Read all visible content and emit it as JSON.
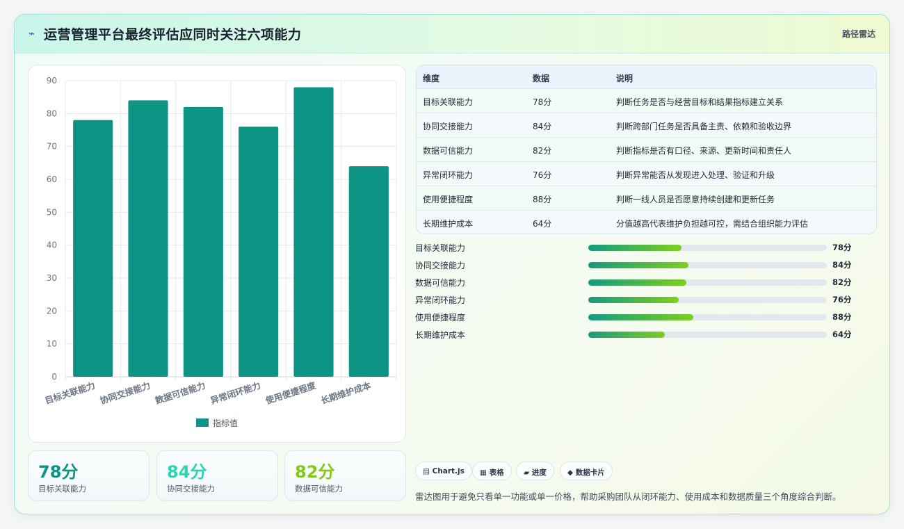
{
  "header": {
    "icon": "lightning-icon",
    "title": "运营管理平台最终评估应同时关注六项能力",
    "tag": "路径雷达"
  },
  "chart_data": {
    "type": "bar",
    "categories": [
      "目标关联能力",
      "协同交接能力",
      "数据可信能力",
      "异常闭环能力",
      "使用便捷程度",
      "长期维护成本"
    ],
    "series": [
      {
        "name": "指标值",
        "values": [
          78,
          84,
          82,
          76,
          88,
          64
        ]
      }
    ],
    "ylim": [
      0,
      90
    ],
    "yticks": [
      0,
      10,
      20,
      30,
      40,
      50,
      60,
      70,
      80,
      90
    ],
    "grid": true,
    "legend": "bottom",
    "bar_color": "#0e9484"
  },
  "stats": [
    {
      "value": "78分",
      "label": "目标关联能力",
      "color": "#0e9484"
    },
    {
      "value": "84分",
      "label": "协同交接能力",
      "color": "#2fd4b4"
    },
    {
      "value": "82分",
      "label": "数据可信能力",
      "color": "#84c81c"
    }
  ],
  "table": {
    "headers": [
      "维度",
      "数据",
      "说明"
    ],
    "rows": [
      [
        "目标关联能力",
        "78分",
        "判断任务是否与经营目标和结果指标建立关系"
      ],
      [
        "协同交接能力",
        "84分",
        "判断跨部门任务是否具备主责、依赖和验收边界"
      ],
      [
        "数据可信能力",
        "82分",
        "判断指标是否有口径、来源、更新时间和责任人"
      ],
      [
        "异常闭环能力",
        "76分",
        "判断异常能否从发现进入处理、验证和升级"
      ],
      [
        "使用便捷程度",
        "88分",
        "判断一线人员是否愿意持续创建和更新任务"
      ],
      [
        "长期维护成本",
        "64分",
        "分值越高代表维护负担越可控，需结合组织能力评估"
      ]
    ]
  },
  "progress": [
    {
      "label": "目标关联能力",
      "value": 78,
      "text": "78分"
    },
    {
      "label": "协同交接能力",
      "value": 84,
      "text": "84分"
    },
    {
      "label": "数据可信能力",
      "value": 82,
      "text": "82分"
    },
    {
      "label": "异常闭环能力",
      "value": 76,
      "text": "76分"
    },
    {
      "label": "使用便捷程度",
      "value": 88,
      "text": "88分"
    },
    {
      "label": "长期维护成本",
      "value": 64,
      "text": "64分"
    }
  ],
  "progress_max": 200,
  "tags": [
    {
      "icon": "chart-icon",
      "label": "Chart.js"
    },
    {
      "icon": "table-icon",
      "label": "表格"
    },
    {
      "icon": "progress-icon",
      "label": "进度"
    },
    {
      "icon": "card-icon",
      "label": "数据卡片"
    }
  ],
  "note": "雷达图用于避免只看单一功能或单一价格，帮助采购团队从闭环能力、使用成本和数据质量三个角度综合判断。"
}
